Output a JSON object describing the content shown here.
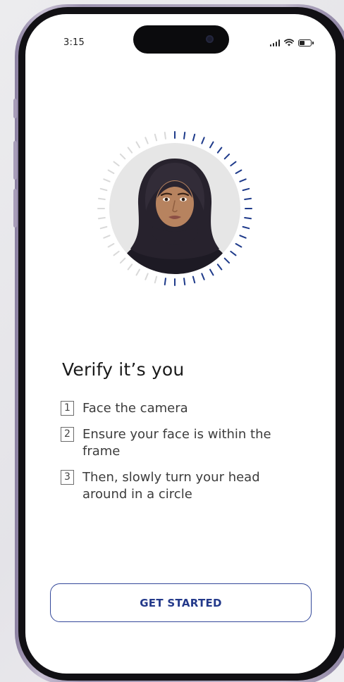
{
  "status_bar": {
    "time": "3:15",
    "signal_bars": 4,
    "wifi_icon": "wifi-icon",
    "battery_level": 0.5
  },
  "verification": {
    "title": "Verify it’s you",
    "steps": [
      {
        "number": "1",
        "text": "Face the camera"
      },
      {
        "number": "2",
        "text": "Ensure your face is within the frame"
      },
      {
        "number": "3",
        "text": "Then, slowly turn your head around in a circle"
      }
    ],
    "progress_ring": {
      "tick_count": 48,
      "active_color": "#1e3a8a",
      "inactive_color": "#d9d9d9"
    }
  },
  "actions": {
    "get_started_label": "GET STARTED"
  },
  "colors": {
    "accent": "#23398a",
    "screen_background": "#ffffff"
  }
}
